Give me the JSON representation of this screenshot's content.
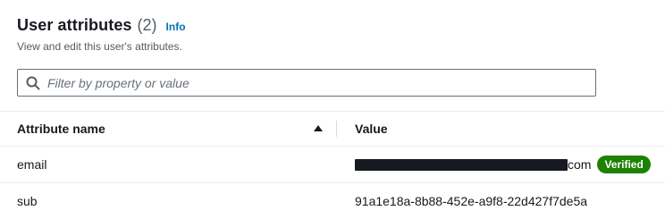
{
  "header": {
    "title": "User attributes",
    "count": "(2)",
    "info_link": "Info",
    "description": "View and edit this user's attributes."
  },
  "filter": {
    "placeholder": "Filter by property or value",
    "value": "",
    "icon": "search-icon"
  },
  "table": {
    "columns": [
      "Attribute name",
      "Value"
    ],
    "sort": {
      "column": "Attribute name",
      "direction": "ascending",
      "icon": "sort-ascending-icon"
    },
    "rows": [
      {
        "name": "email",
        "value_suffix": "com",
        "redacted": true,
        "badge": "Verified"
      },
      {
        "name": "sub",
        "value": "91a1e18a-8b88-452e-a9f8-22d427f7de5a"
      }
    ]
  },
  "colors": {
    "link": "#0073bb",
    "verified_badge": "#1d8102",
    "text": "#16191f",
    "secondary_text": "#545b64"
  }
}
